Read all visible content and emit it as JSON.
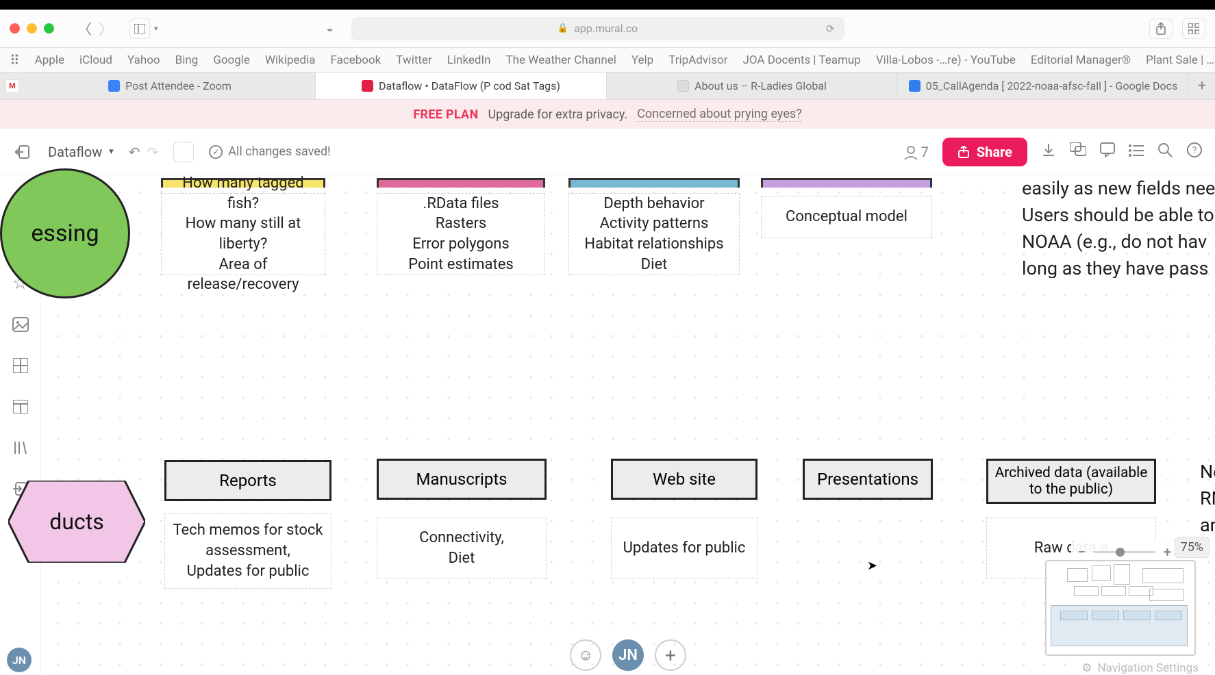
{
  "browser": {
    "url": "app.mural.co",
    "bookmarks": [
      "Apple",
      "iCloud",
      "Yahoo",
      "Bing",
      "Google",
      "Wikipedia",
      "Facebook",
      "Twitter",
      "LinkedIn",
      "The Weather Channel",
      "Yelp",
      "TripAdvisor",
      "JOA Docents | Teamup",
      "Villa-Lobos -…re) - YouTube",
      "Editorial Manager®",
      "Plant Sale | …son Arboretum"
    ],
    "tabs": [
      {
        "label": "Post Attendee - Zoom",
        "active": false,
        "icon": "#3b82f6"
      },
      {
        "label": "Dataflow • DataFlow (P cod Sat Tags)",
        "active": true,
        "icon": "#e11d48"
      },
      {
        "label": "About us – R-Ladies Global",
        "active": false,
        "icon": "#6b46c1"
      },
      {
        "label": "05_CallAgenda [ 2022-noaa-afsc-fall ] - Google Docs",
        "active": false,
        "icon": "#2f80ed"
      }
    ],
    "gmail_badge": "M"
  },
  "promo": {
    "plan": "FREE PLAN",
    "text": "Upgrade for extra privacy.",
    "link": "Concerned about prying eyes?"
  },
  "mural": {
    "title": "Dataflow",
    "saved": "All changes saved!",
    "participants": "7",
    "share": "Share",
    "zoom": "75%",
    "nav_settings": "Navigation Settings",
    "bottom_avatar": "JN",
    "rail_avatar": "JN"
  },
  "canvas": {
    "green": "essing",
    "hex": "ducts",
    "note_right": "easily as new fields nee\nUsers should be able to\nNOAA  (e.g., do not hav\nlong as they have pass",
    "note_far_right": "Ne\nRM\nan",
    "sources": {
      "yellow": "How many tagged fish?\nHow many still at liberty?\nArea of release/recovery",
      "pink": ".RData files\nRasters\nError polygons\nPoint estimates",
      "blue": "Depth behavior\nActivity patterns\nHabitat relationships\nDiet",
      "purple": "Conceptual model"
    },
    "products": {
      "reports": "Reports",
      "manuscripts": "Manuscripts",
      "website": "Web site",
      "presentations": "Presentations",
      "archived": "Archived data (available to the public)"
    },
    "under": {
      "reports": "Tech memos for stock assessment,\nUpdates for public",
      "manuscripts": "Connectivity,\nDiet",
      "website": "Updates for public",
      "archived": "Raw data a"
    }
  }
}
